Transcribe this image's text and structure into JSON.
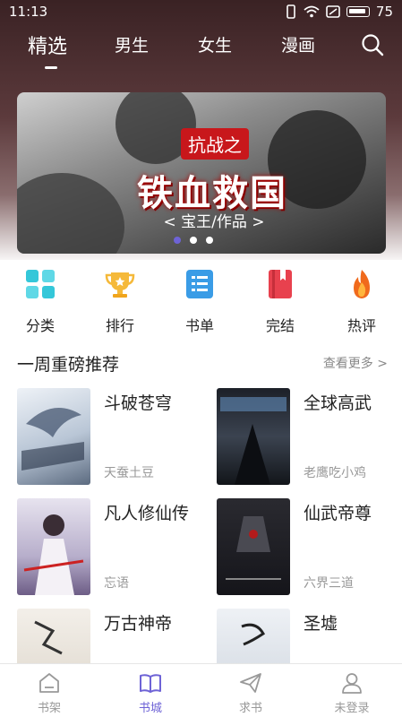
{
  "status_bar": {
    "time": "11:13",
    "battery": "75"
  },
  "top_nav": {
    "tabs": [
      {
        "label": "精选",
        "active": true
      },
      {
        "label": "男生",
        "active": false
      },
      {
        "label": "女生",
        "active": false
      },
      {
        "label": "漫画",
        "active": false
      }
    ],
    "search_icon": "search-icon"
  },
  "banner": {
    "tag": "抗战之",
    "title": "铁血救国",
    "subtitle": "< 宝王/作品 >",
    "dot_count": 3,
    "active_dot": 0
  },
  "categories": [
    {
      "label": "分类",
      "icon": "grid-icon",
      "color": "#34c7d9"
    },
    {
      "label": "排行",
      "icon": "trophy-icon",
      "color": "#f5b93a"
    },
    {
      "label": "书单",
      "icon": "list-icon",
      "color": "#3a9ce6"
    },
    {
      "label": "完结",
      "icon": "book-icon",
      "color": "#e8414e"
    },
    {
      "label": "热评",
      "icon": "flame-icon",
      "color": "#f06a1c"
    }
  ],
  "section": {
    "title": "一周重磅推荐",
    "more": "查看更多 >"
  },
  "books": [
    {
      "title": "斗破苍穹",
      "author": "天蚕土豆",
      "cover_color": "#dfe6ee"
    },
    {
      "title": "全球高武",
      "author": "老鹰吃小鸡",
      "cover_color": "#2c3038"
    },
    {
      "title": "凡人修仙传",
      "author": "忘语",
      "cover_color": "#c9c4d6"
    },
    {
      "title": "仙武帝尊",
      "author": "六界三道",
      "cover_color": "#1e1e22"
    },
    {
      "title": "万古神帝",
      "author": "",
      "cover_color": "#efeae4"
    },
    {
      "title": "圣墟",
      "author": "",
      "cover_color": "#e4e8ee"
    }
  ],
  "bottom_nav": [
    {
      "label": "书架",
      "icon": "shelf-icon",
      "active": false
    },
    {
      "label": "书城",
      "icon": "open-book-icon",
      "active": true
    },
    {
      "label": "求书",
      "icon": "paper-plane-icon",
      "active": false
    },
    {
      "label": "未登录",
      "icon": "user-icon",
      "active": false
    }
  ],
  "colors": {
    "accent": "#6e63d6",
    "banner_red": "#c8171b"
  }
}
